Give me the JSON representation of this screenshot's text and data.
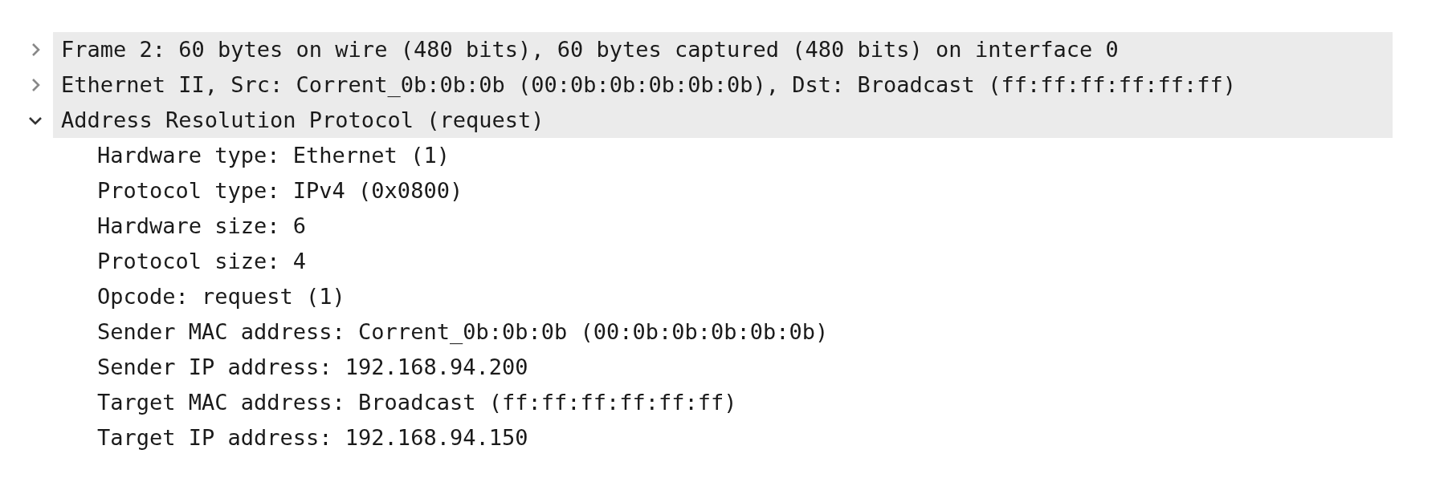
{
  "tree": [
    {
      "label": "Frame 2: 60 bytes on wire (480 bits), 60 bytes captured (480 bits) on interface 0",
      "expanded": false
    },
    {
      "label": "Ethernet II, Src: Corrent_0b:0b:0b (00:0b:0b:0b:0b:0b), Dst: Broadcast (ff:ff:ff:ff:ff:ff)",
      "expanded": false
    },
    {
      "label": "Address Resolution Protocol (request)",
      "expanded": true,
      "children": [
        {
          "label": "Hardware type: Ethernet (1)"
        },
        {
          "label": "Protocol type: IPv4 (0x0800)"
        },
        {
          "label": "Hardware size: 6"
        },
        {
          "label": "Protocol size: 4"
        },
        {
          "label": "Opcode: request (1)"
        },
        {
          "label": "Sender MAC address: Corrent_0b:0b:0b (00:0b:0b:0b:0b:0b)"
        },
        {
          "label": "Sender IP address: 192.168.94.200"
        },
        {
          "label": "Target MAC address: Broadcast (ff:ff:ff:ff:ff:ff)"
        },
        {
          "label": "Target IP address: 192.168.94.150"
        }
      ]
    }
  ]
}
